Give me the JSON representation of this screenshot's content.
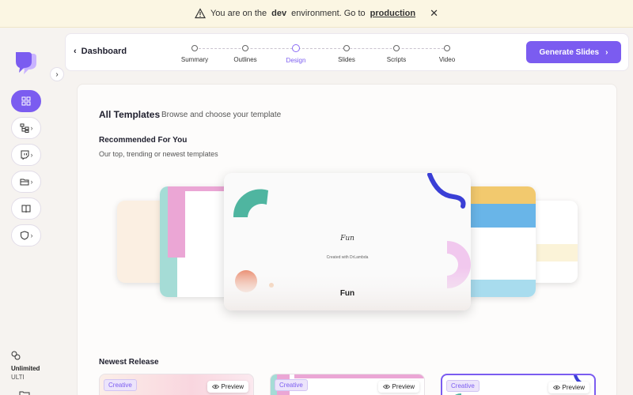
{
  "banner": {
    "prefix": "You are on the",
    "env": "dev",
    "middle": "environment. Go to",
    "link": "production",
    "close": "✕"
  },
  "sidebar": {
    "collapse": "›",
    "plan_name": "Unlimited",
    "plan_tier": "ULTI"
  },
  "header": {
    "back_label": "Dashboard",
    "steps": [
      "Summary",
      "Outlines",
      "Design",
      "Slides",
      "Scripts",
      "Video"
    ],
    "current_step": "Design",
    "generate_label": "Generate Slides"
  },
  "main": {
    "all_title": "All Templates",
    "all_sub": "Browse and choose your template",
    "rec_title": "Recommended For You",
    "rec_sub": "Our top, trending or newest templates",
    "featured": {
      "script": "Fun",
      "credit": "Created with DrLambda",
      "name": "Fun"
    },
    "newest_title": "Newest Release",
    "newest_cards": [
      {
        "badge": "Creative",
        "preview": "Preview"
      },
      {
        "badge": "Creative",
        "preview": "Preview"
      },
      {
        "badge": "Creative",
        "preview": "Preview"
      }
    ]
  },
  "colors": {
    "accent": "#7b5cf0",
    "teal": "#4fb5a0",
    "pink": "#eba6d5",
    "navy": "#3a3fd6",
    "yellow": "#f2c96e",
    "blue": "#69b5e8"
  }
}
